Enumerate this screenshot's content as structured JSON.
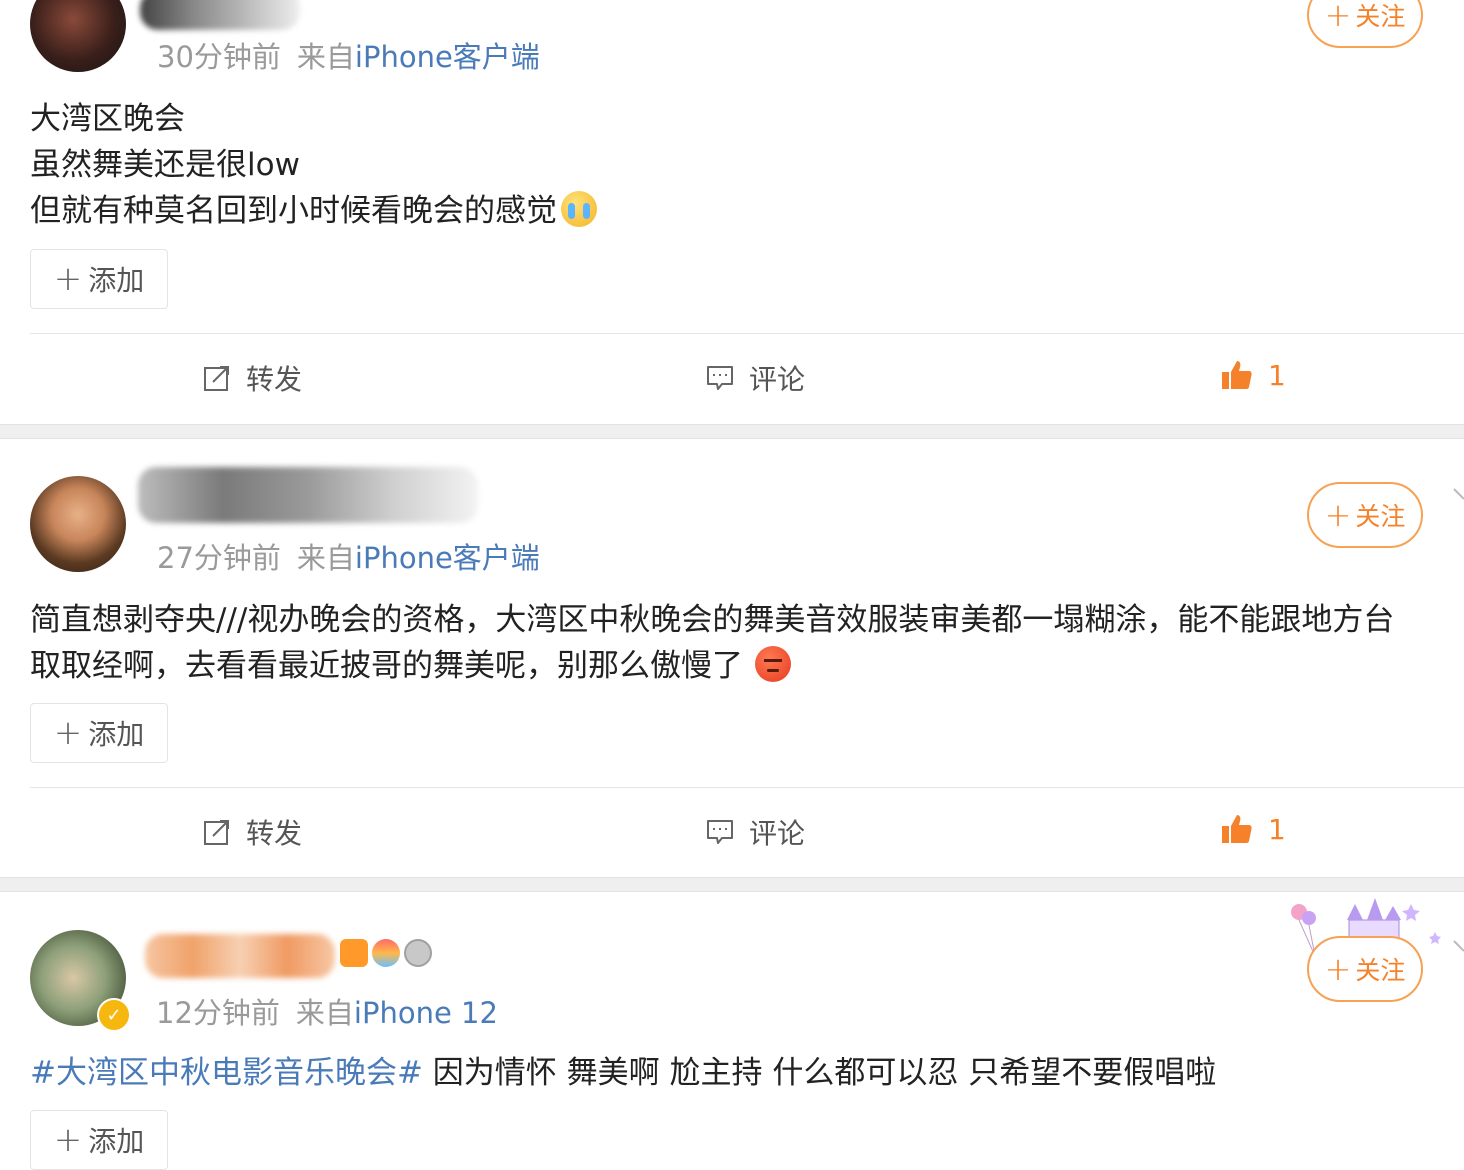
{
  "posts": [
    {
      "meta": {
        "time": "30分钟前",
        "from": "来自",
        "source": "iPhone客户端"
      },
      "follow_label": "关注",
      "content_lines": [
        "大湾区晚会",
        "虽然舞美还是很low",
        "但就有种莫名回到小时候看晚会的感觉"
      ],
      "add_label": "添加",
      "actions": {
        "repost": "转发",
        "comment": "评论",
        "like_count": "1"
      }
    },
    {
      "meta": {
        "time": "27分钟前",
        "from": "来自",
        "source": "iPhone客户端"
      },
      "follow_label": "关注",
      "content_lines": [
        "简直想剥夺央///视办晚会的资格，大湾区中秋晚会的舞美音效服装审美都一塌糊涂，能不能跟地方台",
        "取取经啊，去看看最近披哥的舞美呢，别那么傲慢了"
      ],
      "add_label": "添加",
      "actions": {
        "repost": "转发",
        "comment": "评论",
        "like_count": "1"
      }
    },
    {
      "meta": {
        "time": "12分钟前",
        "from": "来自",
        "source": "iPhone 12"
      },
      "follow_label": "关注",
      "hashtag": "#大湾区中秋电影音乐晚会#",
      "content_text": " 因为情怀 舞美啊 尬主持 什么都可以忍 只希望不要假唱啦",
      "add_label": "添加"
    }
  ],
  "colors": {
    "accent": "#f5822a",
    "link": "#4a7bb8",
    "meta": "#9a9a9a"
  }
}
